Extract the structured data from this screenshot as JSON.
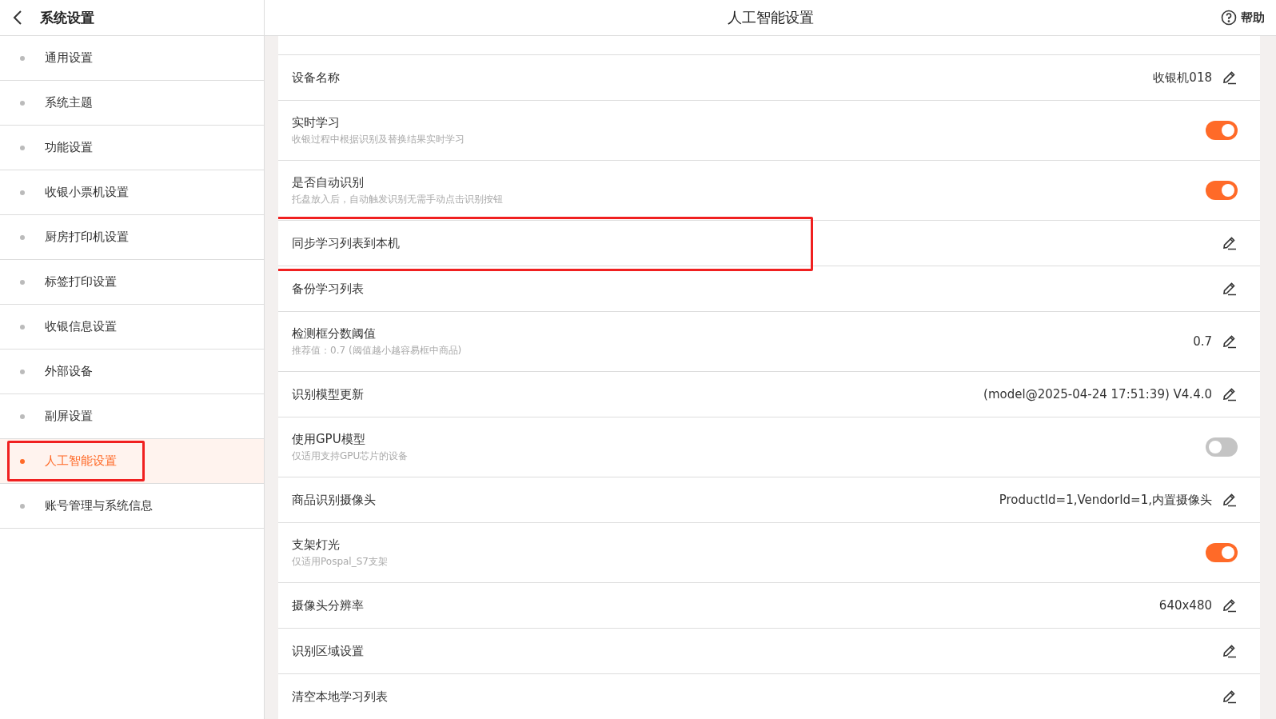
{
  "sidebar": {
    "title": "系统设置",
    "items": [
      {
        "label": "通用设置",
        "selected": false,
        "highlighted": false
      },
      {
        "label": "系统主题",
        "selected": false,
        "highlighted": false
      },
      {
        "label": "功能设置",
        "selected": false,
        "highlighted": false
      },
      {
        "label": "收银小票机设置",
        "selected": false,
        "highlighted": false
      },
      {
        "label": "厨房打印机设置",
        "selected": false,
        "highlighted": false
      },
      {
        "label": "标签打印设置",
        "selected": false,
        "highlighted": false
      },
      {
        "label": "收银信息设置",
        "selected": false,
        "highlighted": false
      },
      {
        "label": "外部设备",
        "selected": false,
        "highlighted": false
      },
      {
        "label": "副屏设置",
        "selected": false,
        "highlighted": false
      },
      {
        "label": "人工智能设置",
        "selected": true,
        "highlighted": true
      },
      {
        "label": "账号管理与系统信息",
        "selected": false,
        "highlighted": false
      }
    ]
  },
  "header": {
    "title": "人工智能设置",
    "help": "帮助"
  },
  "settings": [
    {
      "kind": "edit",
      "label": "设备名称",
      "value": "收银机018",
      "highlighted": false
    },
    {
      "kind": "toggle",
      "label": "实时学习",
      "description": "收银过程中根据识别及替换结果实时学习",
      "on": true,
      "highlighted": false
    },
    {
      "kind": "toggle",
      "label": "是否自动识别",
      "description": "托盘放入后，自动触发识别无需手动点击识别按钮",
      "on": true,
      "highlighted": false
    },
    {
      "kind": "edit",
      "label": "同步学习列表到本机",
      "highlighted": true
    },
    {
      "kind": "edit",
      "label": "备份学习列表",
      "highlighted": false
    },
    {
      "kind": "edit",
      "label": "检测框分数阈值",
      "description": "推荐值：0.7 (阈值越小越容易框中商品)",
      "value": "0.7",
      "highlighted": false
    },
    {
      "kind": "edit",
      "label": "识别模型更新",
      "value": "(model@2025-04-24 17:51:39) V4.4.0",
      "highlighted": false
    },
    {
      "kind": "toggle",
      "label": "使用GPU模型",
      "description": "仅适用支持GPU芯片的设备",
      "on": false,
      "highlighted": false
    },
    {
      "kind": "edit",
      "label": "商品识别摄像头",
      "value": "ProductId=1,VendorId=1,内置摄像头",
      "highlighted": false
    },
    {
      "kind": "toggle",
      "label": "支架灯光",
      "description": "仅适用Pospal_S7支架",
      "on": true,
      "highlighted": false
    },
    {
      "kind": "edit",
      "label": "摄像头分辨率",
      "value": "640x480",
      "highlighted": false
    },
    {
      "kind": "edit",
      "label": "识别区域设置",
      "highlighted": false
    },
    {
      "kind": "edit",
      "label": "清空本地学习列表",
      "highlighted": false
    }
  ]
}
